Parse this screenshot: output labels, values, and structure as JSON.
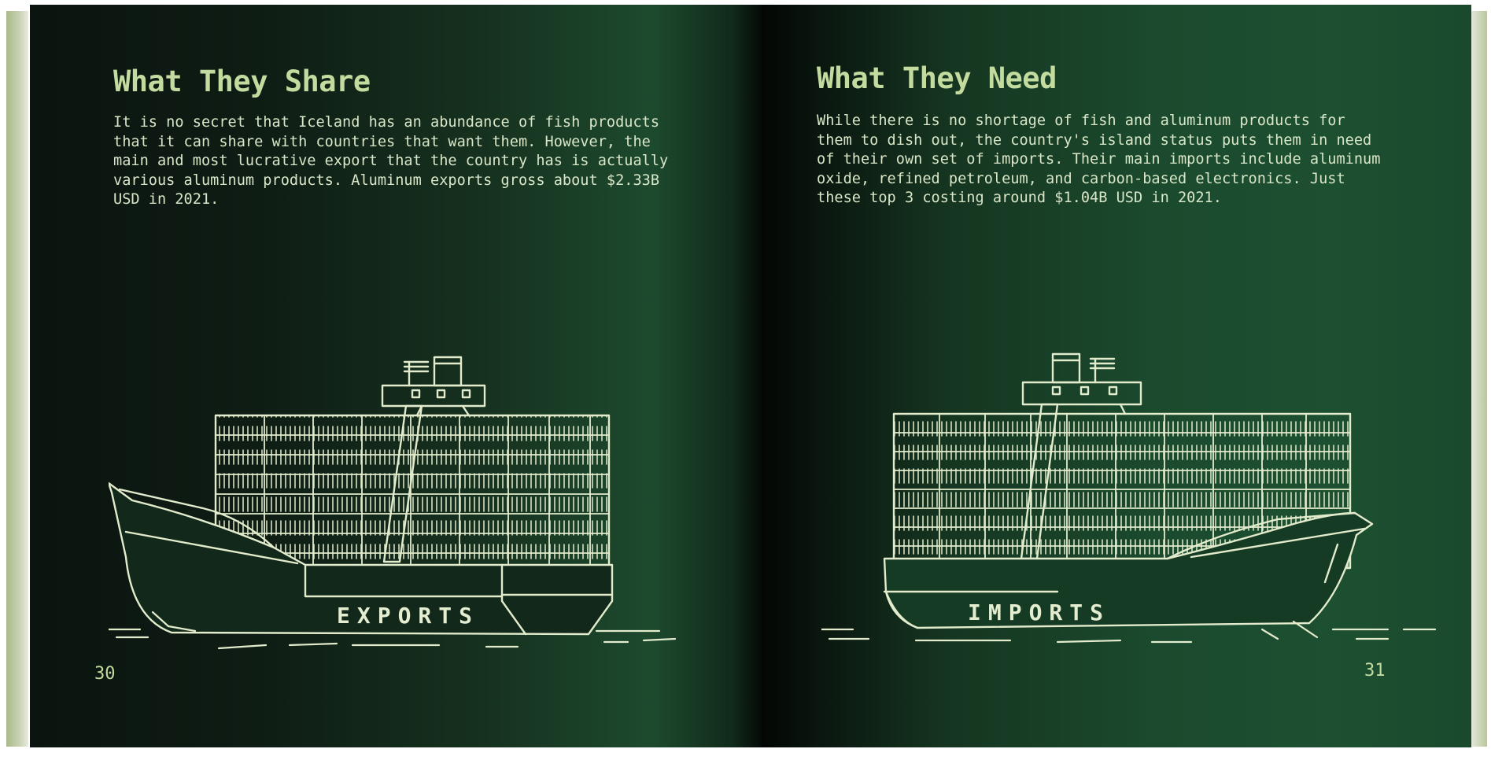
{
  "left_page": {
    "title": "What They Share",
    "paragraph_lines": [
      "It is no secret that Iceland has an abundance of fish products",
      "that it can share with countries that want them. However, the",
      "main and most lucrative export that the country has is actually",
      "various aluminum products. Aluminum exports gross about $2.33B",
      "USD in 2021."
    ],
    "ship_label": "EXPORTS",
    "page_number": "30"
  },
  "right_page": {
    "title": "What They Need",
    "paragraph_lines": [
      "While there is no shortage of fish and aluminum products for",
      "them to dish out, the country's island status puts them in need",
      "of their own set of imports. Their main imports include aluminum",
      "oxide, refined petroleum, and carbon-based electronics. Just",
      "these top 3 costing around $1.04B USD in 2021."
    ],
    "ship_label": "IMPORTS",
    "page_number": "31"
  },
  "colors": {
    "page_green": "#1d4a2e",
    "title_green": "#c4dba0",
    "line_art": "#e2ebcc"
  }
}
